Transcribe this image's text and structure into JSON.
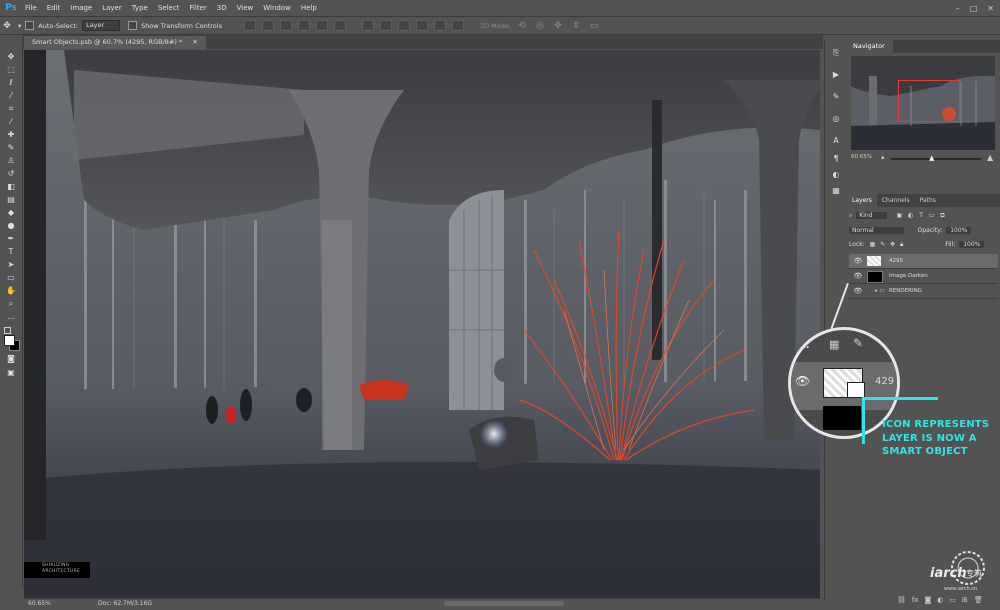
{
  "app": {
    "logo": "Ps"
  },
  "menu": [
    "File",
    "Edit",
    "Image",
    "Layer",
    "Type",
    "Select",
    "Filter",
    "3D",
    "View",
    "Window",
    "Help"
  ],
  "window_controls": [
    "–",
    "□",
    "✕"
  ],
  "options": {
    "auto_select_label": "Auto-Select:",
    "auto_select_value": "Layer",
    "transform_label": "Show Transform Controls",
    "mode_3d": "3D Mode:"
  },
  "document": {
    "tab_label": "Smart Objects.psb @ 60.7% (4295, RGB/8#) *",
    "zoom": "60.65%",
    "doc_size": "Doc: 62.7M/3.16G",
    "credit_line1": "SHIKUZING",
    "credit_line2": "ARCHITECTURE"
  },
  "navigator": {
    "title": "Navigator",
    "zoom": "60.65%"
  },
  "layers": {
    "tabs": [
      "Layers",
      "Channels",
      "Paths"
    ],
    "filter_label": "Kind",
    "blend_mode": "Normal",
    "opacity_label": "Opacity:",
    "opacity_value": "100%",
    "lock_label": "Lock:",
    "fill_label": "Fill:",
    "fill_value": "100%",
    "rows": [
      {
        "name": "4295"
      },
      {
        "name": "Image Darken"
      },
      {
        "name": "RENDERING"
      }
    ]
  },
  "callout": {
    "lock_label": "ck:",
    "layer_number": "429",
    "text_lines": [
      "ICON REPRESENTS",
      "LAYER IS NOW A",
      "SMART OBJECT"
    ]
  },
  "watermark": {
    "text1": "iarch",
    "text2": "专筑",
    "url": "www.iarch.cn"
  },
  "colors": {
    "accent_cyan": "#2ee6e6",
    "nav_rect": "#e63a3a",
    "ps_blue": "#31a8ff"
  }
}
